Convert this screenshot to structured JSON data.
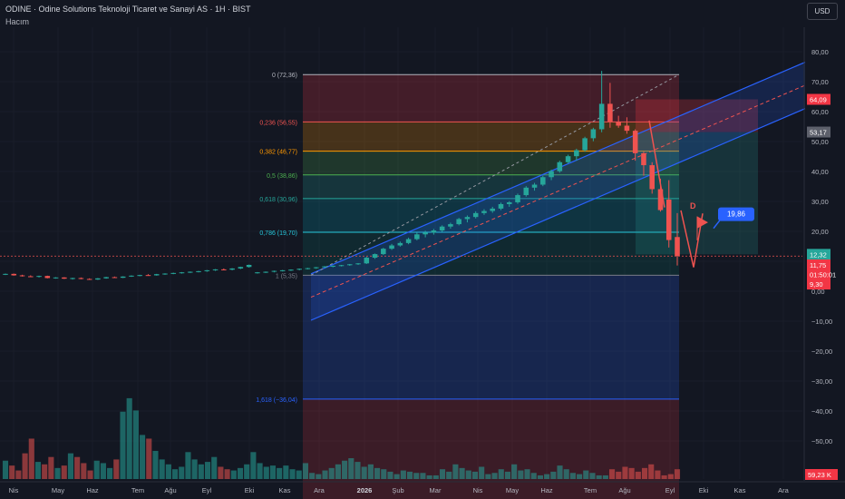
{
  "header": {
    "title": "ODINE · Odine Solutions Teknoloji Ticaret ve Sanayi AS · 1H · BIST",
    "volume_label": "Hacım"
  },
  "currency_button": "USD",
  "colors": {
    "background": "#131722",
    "up": "#26a69a",
    "down": "#ef5350",
    "channel": "#2962ff",
    "grid": "#1e222d"
  },
  "chart_data": {
    "type": "candlestick",
    "symbol": "ODINE",
    "x_ticks": [
      "Nis",
      "May",
      "Haz",
      "Tem",
      "Ağu",
      "Eyl",
      "Eki",
      "Kas",
      "Ara",
      "2026",
      "Şub",
      "Mar",
      "Nis",
      "May",
      "Haz",
      "Tem",
      "Ağu",
      "Eyl",
      "Eki",
      "Kas",
      "Ara"
    ],
    "y_ticks": [
      "80,00",
      "70,00",
      "60,00",
      "50,00",
      "40,00",
      "30,00",
      "20,00",
      "10,00",
      "0,00",
      "−10,00",
      "−20,00",
      "−30,00",
      "−40,00",
      "−50,00"
    ],
    "ylim": [
      -55,
      82
    ],
    "fib_levels": [
      {
        "label": "0 (72,36)",
        "value": 72.36,
        "color": "#b2b5be"
      },
      {
        "label": "0,236 (56,55)",
        "value": 56.55,
        "color": "#ef5350"
      },
      {
        "label": "0,382 (46,77)",
        "value": 46.77,
        "color": "#ff9800"
      },
      {
        "label": "0,5 (38,86)",
        "value": 38.86,
        "color": "#4caf50"
      },
      {
        "label": "0,618 (30,96)",
        "value": 30.96,
        "color": "#26a69a"
      },
      {
        "label": "0,786 (19,70)",
        "value": 19.7,
        "color": "#26c6da"
      },
      {
        "label": "1 (5,35)",
        "value": 5.35,
        "color": "#787b86"
      },
      {
        "label": "1,618 (−36,04)",
        "value": -36.04,
        "color": "#2962ff"
      }
    ],
    "price_labels": [
      {
        "text": "64,09",
        "value": 64.09,
        "color": "#f23645"
      },
      {
        "text": "53,17",
        "value": 53.17,
        "color": "#5d606b"
      },
      {
        "text": "12,32",
        "value": 12.32,
        "color": "#26a69a"
      },
      {
        "text": "11,75",
        "value": 8.8,
        "color": "#f23645"
      },
      {
        "text": "01:50:01",
        "value": 5.6,
        "color": "#f23645"
      },
      {
        "text": "9,30",
        "value": 2.4,
        "color": "#f23645"
      }
    ],
    "volume_label": "59,23 K",
    "annotations": {
      "pattern_point": "D",
      "target_value": "19,86"
    },
    "candles": [
      [
        5.5,
        5.9,
        5.4,
        5.8
      ],
      [
        5.8,
        5.9,
        5.2,
        5.3
      ],
      [
        5.3,
        5.5,
        4.9,
        5.0
      ],
      [
        5.0,
        5.3,
        4.7,
        4.8
      ],
      [
        4.8,
        5.2,
        4.6,
        5.1
      ],
      [
        5.1,
        5.2,
        4.3,
        4.4
      ],
      [
        4.4,
        4.7,
        4.2,
        4.6
      ],
      [
        4.6,
        4.7,
        4.1,
        4.2
      ],
      [
        4.2,
        4.5,
        3.9,
        4.4
      ],
      [
        4.4,
        4.6,
        4.0,
        4.1
      ],
      [
        4.1,
        4.3,
        3.8,
        3.9
      ],
      [
        3.9,
        4.4,
        3.8,
        4.3
      ],
      [
        4.3,
        4.8,
        4.2,
        4.7
      ],
      [
        4.7,
        4.9,
        4.4,
        4.5
      ],
      [
        4.5,
        5.0,
        4.4,
        4.9
      ],
      [
        4.9,
        5.3,
        4.8,
        5.2
      ],
      [
        5.2,
        5.5,
        5.0,
        5.4
      ],
      [
        5.4,
        5.7,
        5.2,
        5.3
      ],
      [
        5.3,
        5.8,
        5.2,
        5.7
      ],
      [
        5.7,
        6.0,
        5.5,
        5.9
      ],
      [
        5.9,
        6.2,
        5.7,
        6.1
      ],
      [
        6.1,
        6.4,
        5.9,
        6.3
      ],
      [
        6.3,
        6.6,
        6.1,
        6.5
      ],
      [
        6.5,
        6.8,
        6.3,
        6.7
      ],
      [
        6.7,
        7.1,
        6.5,
        7.0
      ],
      [
        7.0,
        7.4,
        6.8,
        7.3
      ],
      [
        7.3,
        7.6,
        7.0,
        7.2
      ],
      [
        7.2,
        7.7,
        7.0,
        7.6
      ],
      [
        7.6,
        8.2,
        7.4,
        8.1
      ],
      [
        8.1,
        8.9,
        7.9,
        8.8
      ],
      [
        6.1,
        6.4,
        5.9,
        6.3
      ],
      [
        6.3,
        6.6,
        6.1,
        6.5
      ],
      [
        6.5,
        6.9,
        6.3,
        6.8
      ],
      [
        6.8,
        7.1,
        6.6,
        7.0
      ],
      [
        7.0,
        7.3,
        6.8,
        7.2
      ],
      [
        7.2,
        7.6,
        7.0,
        7.5
      ],
      [
        7.5,
        7.8,
        7.3,
        7.7
      ],
      [
        7.7,
        8.1,
        7.5,
        8.0
      ],
      [
        8.0,
        8.4,
        7.8,
        8.3
      ],
      [
        8.3,
        8.6,
        8.0,
        8.5
      ],
      [
        8.5,
        8.8,
        8.3,
        8.7
      ],
      [
        8.7,
        9.1,
        8.5,
        9.0
      ],
      [
        9.0,
        9.4,
        8.8,
        9.3
      ],
      [
        9.3,
        11.5,
        9.1,
        11.2
      ],
      [
        11.2,
        12.6,
        10.8,
        12.4
      ],
      [
        12.4,
        14.5,
        12.1,
        14.2
      ],
      [
        14.2,
        15.8,
        13.8,
        15.3
      ],
      [
        15.3,
        16.6,
        14.9,
        16.1
      ],
      [
        16.1,
        17.9,
        15.7,
        17.4
      ],
      [
        17.4,
        19.6,
        17.0,
        19.0
      ],
      [
        19.0,
        20.2,
        18.0,
        19.6
      ],
      [
        19.6,
        20.8,
        18.9,
        20.3
      ],
      [
        20.3,
        22.0,
        19.8,
        21.6
      ],
      [
        21.6,
        22.9,
        20.9,
        22.4
      ],
      [
        22.4,
        24.5,
        22.0,
        24.1
      ],
      [
        24.1,
        25.3,
        23.0,
        24.8
      ],
      [
        24.8,
        26.7,
        24.3,
        26.1
      ],
      [
        26.1,
        27.4,
        25.5,
        26.8
      ],
      [
        26.8,
        28.2,
        26.2,
        27.6
      ],
      [
        27.6,
        29.6,
        27.1,
        29.1
      ],
      [
        29.1,
        30.1,
        28.2,
        29.7
      ],
      [
        29.7,
        32.6,
        29.2,
        32.1
      ],
      [
        32.1,
        35.1,
        31.6,
        34.6
      ],
      [
        34.6,
        36.2,
        33.6,
        35.6
      ],
      [
        35.6,
        38.6,
        35.1,
        38.1
      ],
      [
        38.1,
        40.6,
        37.1,
        40.1
      ],
      [
        40.1,
        43.6,
        39.6,
        43.1
      ],
      [
        43.1,
        45.6,
        42.6,
        45.1
      ],
      [
        45.1,
        47.6,
        43.6,
        47.1
      ],
      [
        47.1,
        51.6,
        46.6,
        51.1
      ],
      [
        51.1,
        54.6,
        50.1,
        54.1
      ],
      [
        54.1,
        73.6,
        53.1,
        62.6
      ],
      [
        62.6,
        69.6,
        54.6,
        56.6
      ],
      [
        56.6,
        58.6,
        54.6,
        55.3
      ],
      [
        55.3,
        58.1,
        52.6,
        53.6
      ],
      [
        53.6,
        54.1,
        43.6,
        46.1
      ],
      [
        46.1,
        46.6,
        38.6,
        42.1
      ],
      [
        42.1,
        43.1,
        32.6,
        34.1
      ],
      [
        34.1,
        37.6,
        26.6,
        27.1
      ],
      [
        30.6,
        37.1,
        14.6,
        17.1
      ],
      [
        18.1,
        26.1,
        8.6,
        11.75
      ]
    ],
    "volumes": [
      0.15,
      0.11,
      0.07,
      0.21,
      0.33,
      0.14,
      0.12,
      0.18,
      0.09,
      0.11,
      0.21,
      0.18,
      0.13,
      0.07,
      0.15,
      0.13,
      0.09,
      0.16,
      0.55,
      0.66,
      0.56,
      0.36,
      0.33,
      0.23,
      0.16,
      0.12,
      0.08,
      0.1,
      0.22,
      0.16,
      0.12,
      0.14,
      0.18,
      0.1,
      0.08,
      0.07,
      0.09,
      0.12,
      0.22,
      0.13,
      0.1,
      0.11,
      0.09,
      0.11,
      0.08,
      0.07,
      0.13,
      0.05,
      0.04,
      0.07,
      0.09,
      0.12,
      0.15,
      0.17,
      0.14,
      0.1,
      0.12,
      0.09,
      0.08,
      0.06,
      0.04,
      0.07,
      0.06,
      0.05,
      0.05,
      0.03,
      0.03,
      0.08,
      0.06,
      0.12,
      0.09,
      0.07,
      0.06,
      0.1,
      0.04,
      0.05,
      0.08,
      0.06,
      0.12,
      0.07,
      0.08,
      0.05,
      0.03,
      0.04,
      0.06,
      0.11,
      0.08,
      0.05,
      0.04,
      0.07,
      0.05,
      0.03,
      0.03,
      0.08,
      0.06,
      0.1,
      0.09,
      0.06,
      0.09,
      0.12,
      0.07,
      0.03,
      0.04,
      0.08
    ]
  }
}
